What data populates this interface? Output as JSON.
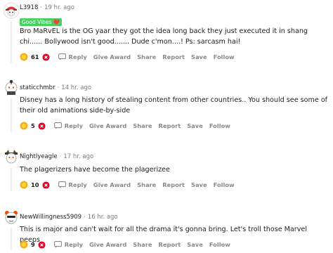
{
  "comments": [
    {
      "username": "L3918",
      "time": "19 hr. ago",
      "flair": "Good Vibes ❤️",
      "text": "Bro MaRvEL is the OG yaar they got the idea long back they just executed it in shang chi...... Bollywood isn't good....... Dude c'mon....! Ps: sarcasm hai!",
      "score": "61"
    },
    {
      "username": "staticchmbr",
      "time": "14 hr. ago",
      "text": "Disney has a long history of stealing content from other countries.. You should see some of their old animations side-by-side",
      "score": "5"
    },
    {
      "username": "Nightlyeagle",
      "time": "17 hr. ago",
      "text": "The plagerizers have become the plagerizee",
      "score": "10"
    },
    {
      "username": "NewWillingness5909",
      "time": "16 hr. ago",
      "text": "This is major and can't wait for all the drama it's gonna bring. Let's troll those Marvel peeps",
      "score": "9"
    }
  ],
  "actions": {
    "reply": "Reply",
    "give_award": "Give Award",
    "share": "Share",
    "report": "Report",
    "save": "Save",
    "follow": "Follow"
  },
  "meta_separator": "·",
  "colors": {
    "flair_bg": "#46d160",
    "downvote": "#ea0027",
    "award_gold": "#f2b01e",
    "muted": "#878a8c"
  }
}
